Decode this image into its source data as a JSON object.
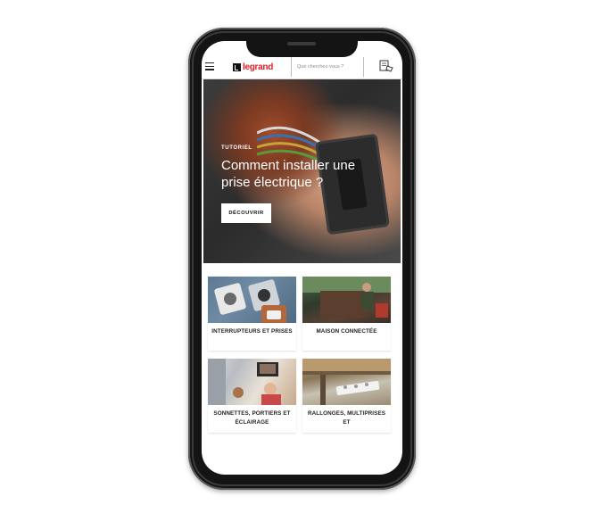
{
  "header": {
    "logo_text": "legrand",
    "search_placeholder": "Que cherchez-vous ?"
  },
  "hero": {
    "tag": "TUTORIEL",
    "title": "Comment installer une prise électrique ?",
    "button_label": "DÉCOUVRIR"
  },
  "categories": [
    {
      "label": "INTERRUPTEURS ET PRISES"
    },
    {
      "label": "MAISON CONNECTÉE"
    },
    {
      "label": "SONNETTES, PORTIERS ET ÉCLAIRAGE"
    },
    {
      "label": "RALLONGES, MULTIPRISES ET"
    }
  ],
  "colors": {
    "brand_red": "#e01e2a",
    "phone_frame": "#141414"
  },
  "icons": [
    "menu-icon",
    "cart-icon"
  ]
}
